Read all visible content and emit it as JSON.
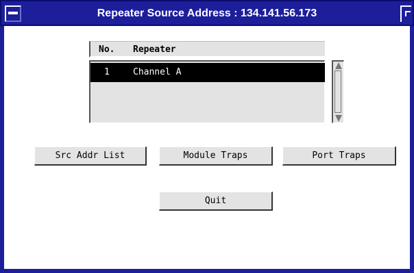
{
  "window": {
    "title": "Repeater Source Address : 134.141.56.173",
    "title_bg": "#1d1e9a"
  },
  "list": {
    "headers": {
      "no": "No.",
      "repeater": "Repeater"
    },
    "rows": [
      {
        "no": "1",
        "repeater": "Channel A",
        "selected": true
      }
    ]
  },
  "buttons": {
    "src_addr_list": "Src Addr List",
    "module_traps": "Module Traps",
    "port_traps": "Port Traps",
    "quit": "Quit"
  }
}
